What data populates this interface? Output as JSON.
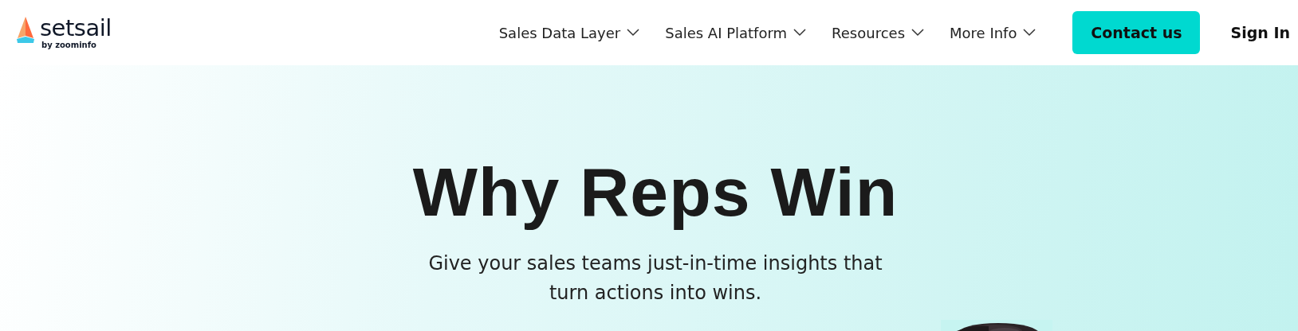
{
  "header": {
    "logo": {
      "name": "setsail",
      "tagline": "by zoominfo"
    },
    "nav": [
      {
        "label": "Sales Data Layer",
        "has_menu": true
      },
      {
        "label": "Sales AI Platform",
        "has_menu": true
      },
      {
        "label": "Resources",
        "has_menu": true
      },
      {
        "label": "More Info",
        "has_menu": true
      }
    ],
    "contact_button": "Contact us",
    "sign_in": "Sign In"
  },
  "hero": {
    "title": "Why Reps Win",
    "subtitle": "Give your sales teams just-in-time insights that turn actions into wins."
  }
}
